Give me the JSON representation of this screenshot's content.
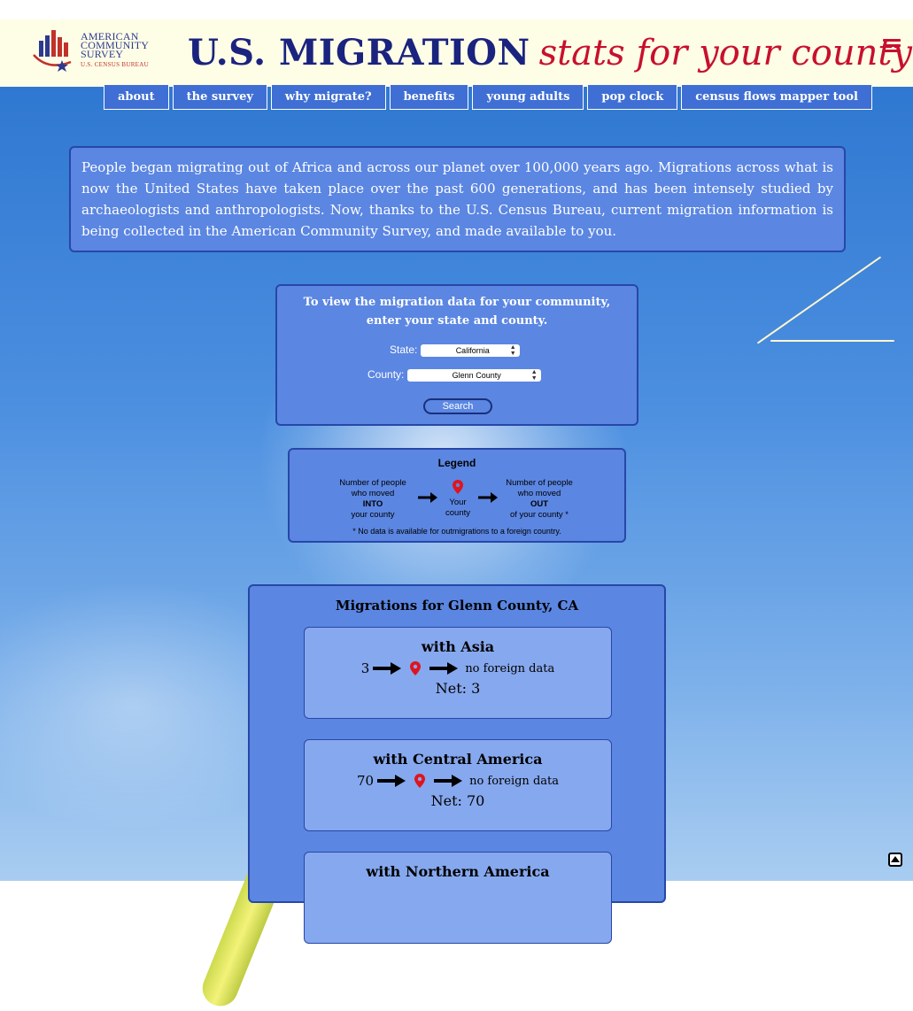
{
  "header": {
    "logo": {
      "line1": "AMERICAN",
      "line2": "COMMUNITY",
      "line3": "SURVEY",
      "sub": "U.S. CENSUS BUREAU"
    },
    "title_main": "U.S. MIGRATION",
    "title_sub": "stats for your county",
    "menu_icon": "hamburger-icon"
  },
  "nav": {
    "items": [
      "about",
      "the survey",
      "why migrate?",
      "benefits",
      "young adults",
      "pop clock",
      "census flows mapper tool"
    ]
  },
  "intro": {
    "text": "People began migrating out of Africa and across our planet over 100,000 years ago. Migrations across what is now the United States have taken place over the past 600 generations, and has been intensely studied by archaeologists and anthropologists. Now, thanks to the U.S. Census Bureau, current migration information is being collected in the American Community Survey, and made available to you."
  },
  "search": {
    "prompt_line1": "To view the migration data for your community,",
    "prompt_line2": "enter your state and county.",
    "state_label": "State:",
    "state_value": "California",
    "county_label": "County:",
    "county_value": "Glenn County",
    "button": "Search"
  },
  "legend": {
    "title": "Legend",
    "into_line1": "Number of people",
    "into_line2": "who moved",
    "into_line3": "INTO",
    "into_line4": "your county",
    "center_line1": "Your",
    "center_line2": "county",
    "out_line1": "Number of people",
    "out_line2": "who moved",
    "out_line3": "OUT",
    "out_line4": "of your county *",
    "note": "* No data is available for outmigrations to a foreign country."
  },
  "migrations": {
    "title": "Migrations for Glenn County, CA",
    "cards": [
      {
        "title": "with Asia",
        "in": "3",
        "out": "no foreign data",
        "net": "Net: 3"
      },
      {
        "title": "with Central America",
        "in": "70",
        "out": "no foreign data",
        "net": "Net: 70"
      },
      {
        "title": "with Northern America",
        "in": "",
        "out": "",
        "net": ""
      }
    ]
  },
  "colors": {
    "title_main": "#1a237e",
    "title_sub": "#c8102e",
    "panel_bg": "#5b86e2",
    "card_bg": "#86a8ee",
    "pin": "#e0141e"
  }
}
